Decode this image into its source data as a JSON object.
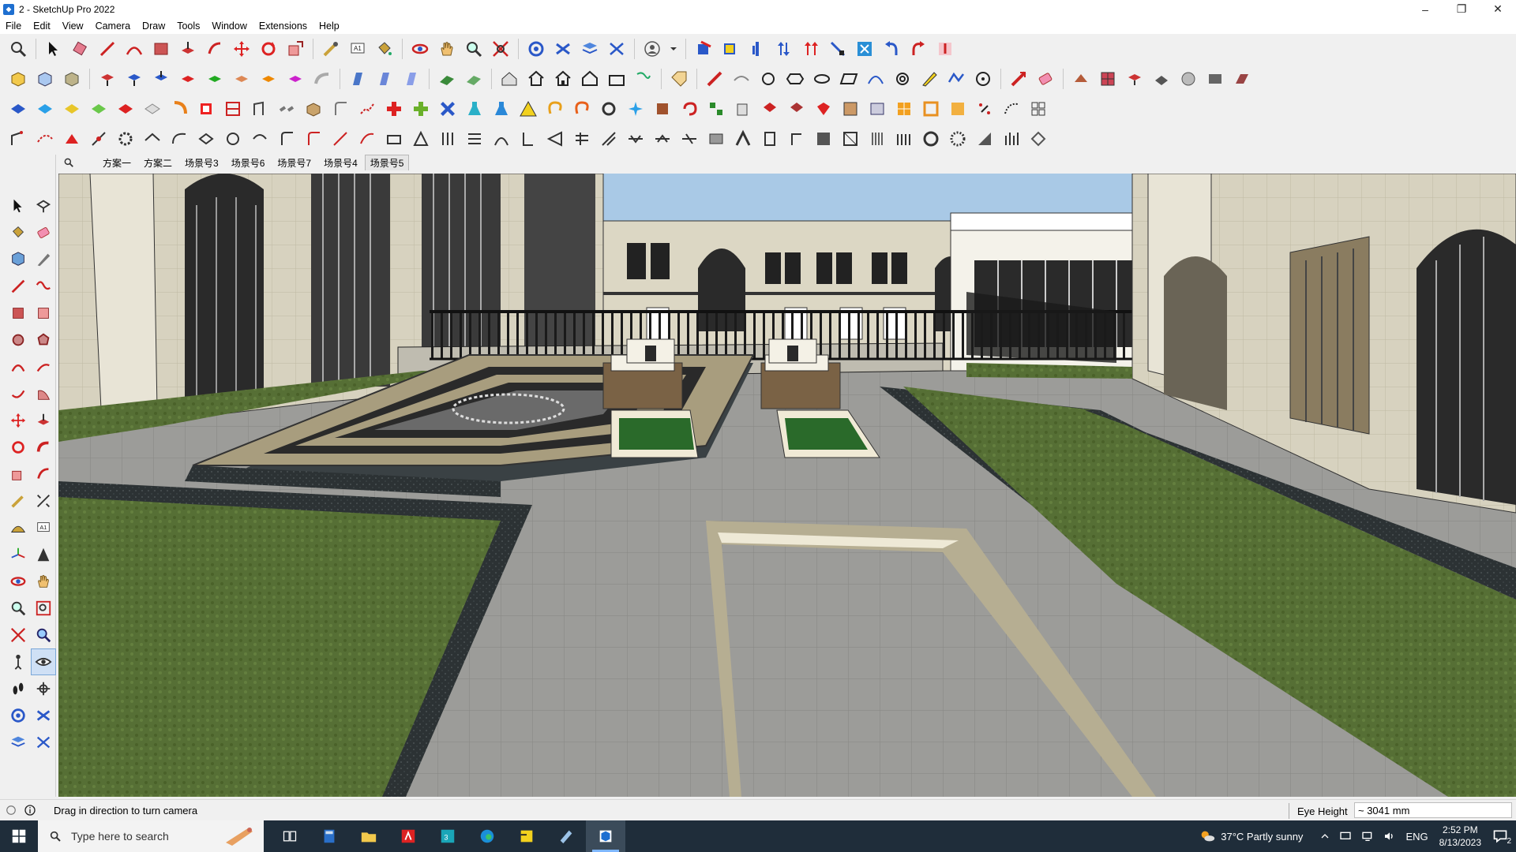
{
  "window": {
    "title": "2 - SketchUp Pro 2022",
    "minimize": "–",
    "restore": "❐",
    "close": "✕"
  },
  "menu": [
    "File",
    "Edit",
    "View",
    "Camera",
    "Draw",
    "Tools",
    "Window",
    "Extensions",
    "Help"
  ],
  "scenes": {
    "tabs": [
      "方案一",
      "方案二",
      "场景号3",
      "场景号6",
      "场景号7",
      "场景号4",
      "场景号5"
    ],
    "active_index": 6
  },
  "status": {
    "message": "Drag in direction to turn camera",
    "measure_label": "Eye Height",
    "measure_value": "~ 3041 mm"
  },
  "taskbar": {
    "search_placeholder": "Type here to search",
    "weather": "37°C  Partly sunny",
    "language": "ENG",
    "time": "2:52 PM",
    "date": "8/13/2023",
    "notification_count": "2"
  },
  "colors": {
    "sky": "#a9c9e6",
    "grass": "#5a7a3a",
    "paving": "#9a9a98",
    "taskbar": "#1f2d3a"
  }
}
